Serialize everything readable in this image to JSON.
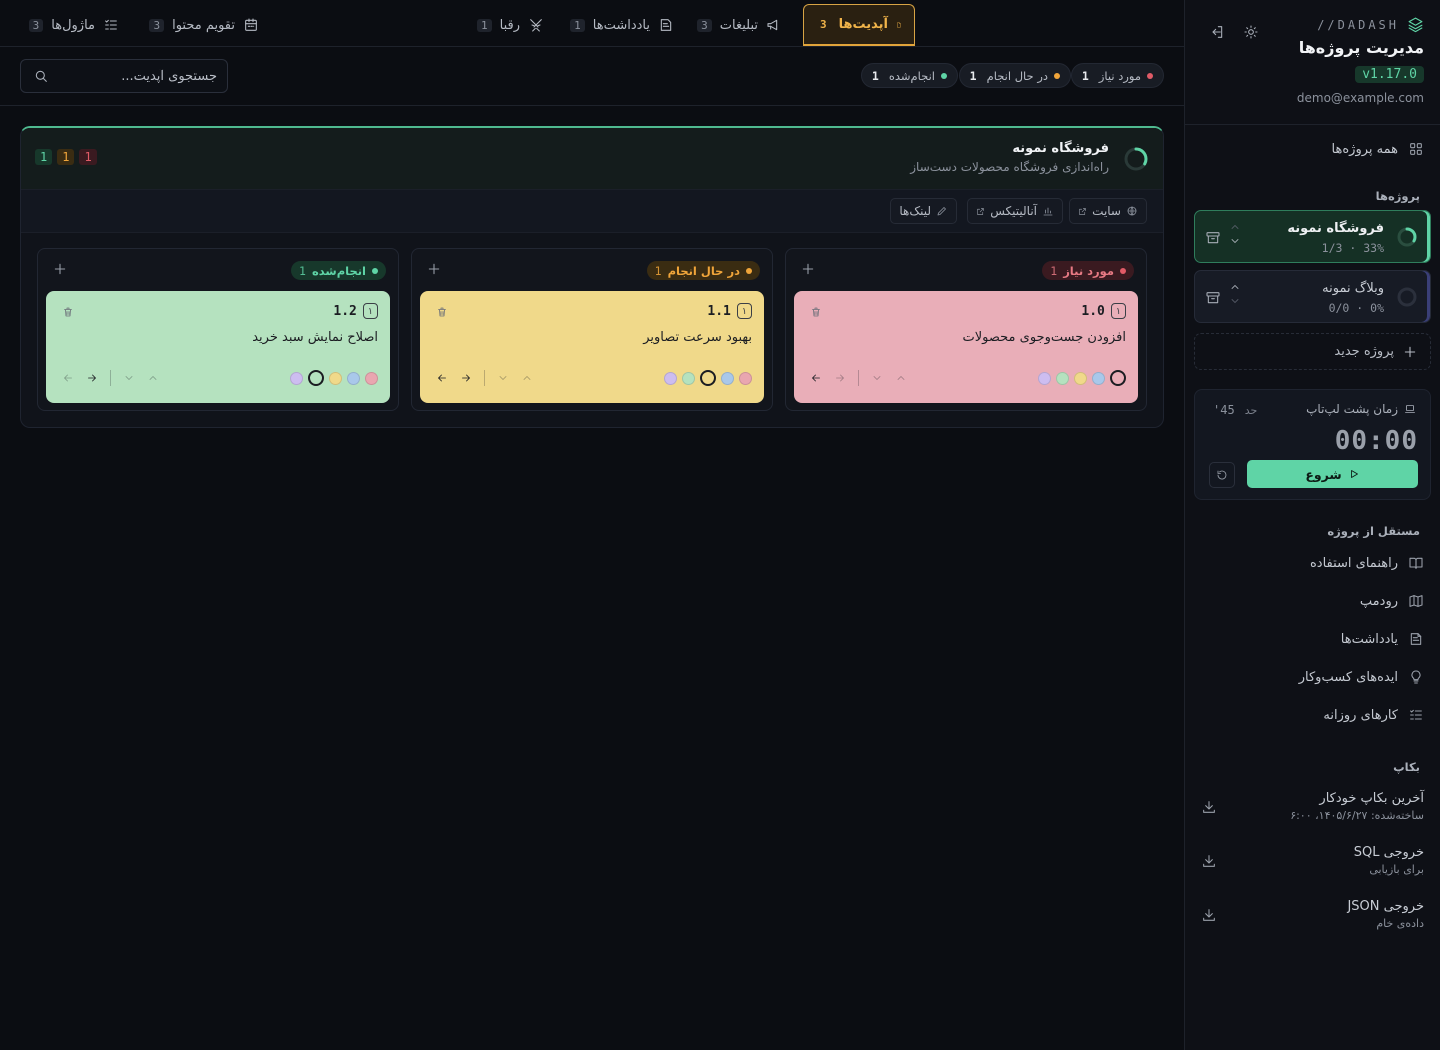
{
  "sidebar": {
    "brand": "//DADASH",
    "title": "مدیریت پروژه‌ها",
    "version": "v1.17.0",
    "email": "demo@example.com",
    "all_projects": "همه پروژه‌ها",
    "projects_label": "پروژه‌ها",
    "projects": [
      {
        "name": "فروشگاه نمونه",
        "percent": "33%",
        "progress": "1/3",
        "progress_fraction": 0.33
      },
      {
        "name": "وبلاگ نمونه",
        "percent": "0%",
        "progress": "0/0",
        "progress_fraction": 0
      }
    ],
    "new_project": "پروژه جدید",
    "timer": {
      "label": "زمان پشت لپ‌تاپ",
      "limit_label": "حد",
      "limit_value": "45'",
      "time": "00:00",
      "start": "شروع"
    },
    "independent_label": "مستقل از پروژه",
    "independent_items": [
      {
        "label": "راهنمای استفاده",
        "icon": "book-icon"
      },
      {
        "label": "رودمپ",
        "icon": "map-icon"
      },
      {
        "label": "یادداشت‌ها",
        "icon": "notes-icon"
      },
      {
        "label": "ایده‌های کسب‌وکار",
        "icon": "bulb-icon"
      },
      {
        "label": "کارهای روزانه",
        "icon": "checklist-icon"
      }
    ],
    "backup_label": "بکاپ",
    "backups": [
      {
        "title": "آخرین بکاپ خودکار",
        "sub": "ساخته‌شده: ۱۴۰۵/۶/۲۷، ۶:۰۰"
      },
      {
        "title": "خروجی SQL",
        "sub": "برای بازیابی"
      },
      {
        "title": "خروجی JSON",
        "sub": "داده‌ی خام"
      }
    ]
  },
  "tabs": [
    {
      "label": "ماژول‌ها",
      "count": "3"
    },
    {
      "label": "تقویم محتوا",
      "count": "3"
    },
    {
      "label": "آپدیت‌ها",
      "count": "3"
    },
    {
      "label": "تبلیغات",
      "count": "3"
    },
    {
      "label": "یادداشت‌ها",
      "count": "1"
    },
    {
      "label": "رقبا",
      "count": "1"
    }
  ],
  "filters": {
    "search_placeholder": "جستجوی آپدیت...",
    "pills": [
      {
        "label": "مورد نیاز",
        "count": "1",
        "color": "#e05b67"
      },
      {
        "label": "در حال انجام",
        "count": "1",
        "color": "#f0a53a"
      },
      {
        "label": "انجام‌شده",
        "count": "1",
        "color": "#5fd4a6"
      }
    ]
  },
  "project": {
    "title": "فروشگاه نمونه",
    "subtitle": "راه‌اندازی فروشگاه محصولات دست‌ساز",
    "counts": {
      "todo": "1",
      "doing": "1",
      "done": "1"
    },
    "progress_fraction": 0.33,
    "links": [
      {
        "label": "سایت"
      },
      {
        "label": "آنالیتیکس"
      },
      {
        "label": "لینک‌ها"
      }
    ],
    "columns": [
      {
        "label": "مورد نیاز",
        "count": "1",
        "color": "#e05b67",
        "card": {
          "version": "1.0",
          "priority": "۱",
          "title": "افزودن جست‌وجوی محصولات",
          "bg": "#e9aeb8"
        }
      },
      {
        "label": "در حال انجام",
        "count": "1",
        "color": "#f0a53a",
        "card": {
          "version": "1.1",
          "priority": "۱",
          "title": "بهبود سرعت تصاویر",
          "bg": "#f0d98a"
        }
      },
      {
        "label": "انجام‌شده",
        "count": "1",
        "color": "#5fd4a6",
        "card": {
          "version": "1.2",
          "priority": "۱",
          "title": "اصلاح نمایش سبد خرید",
          "bg": "#b5e2bf"
        }
      }
    ]
  },
  "colors": {
    "accent": "#5fd4a6",
    "tab_active": "#f1b44a",
    "swatches": [
      "#e9a6b0",
      "#a9c8ea",
      "#f0d98a",
      "#b5e2bf",
      "#cdbdf0"
    ]
  }
}
